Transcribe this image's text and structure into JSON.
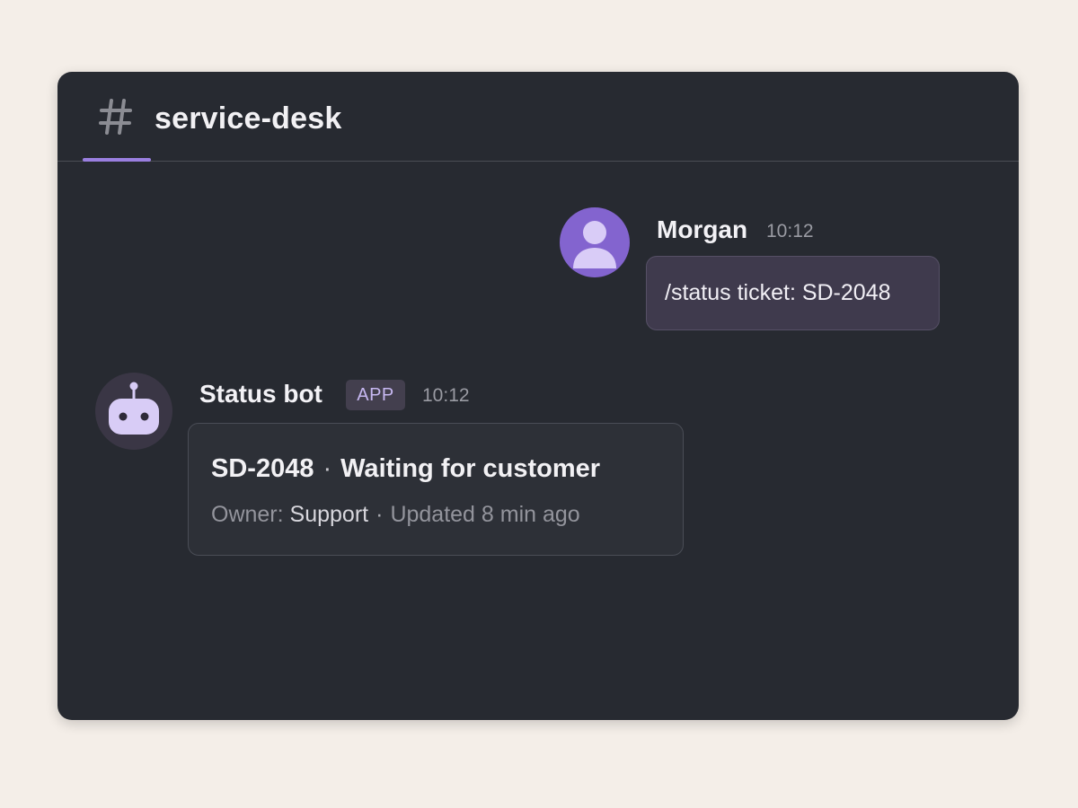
{
  "channel": {
    "name": "service-desk",
    "icon": "hash-icon"
  },
  "colors": {
    "page_background": "#f4eee8",
    "window_background": "#272a31",
    "accent": "#9a7fe0",
    "user_avatar": "#8364cf",
    "bubble": "#3f3a4d"
  },
  "messages": [
    {
      "author": "Morgan",
      "time": "10:12",
      "avatar_icon": "user-avatar-icon",
      "text": "/status ticket: SD-2048"
    },
    {
      "author": "Status bot",
      "badge": "APP",
      "time": "10:12",
      "avatar_icon": "robot-icon",
      "card": {
        "ticket_id": "SD-2048",
        "separator": "·",
        "status": "Waiting for customer",
        "owner_label": "Owner:",
        "owner_value": "Support",
        "updated": "Updated 8 min ago"
      }
    }
  ]
}
